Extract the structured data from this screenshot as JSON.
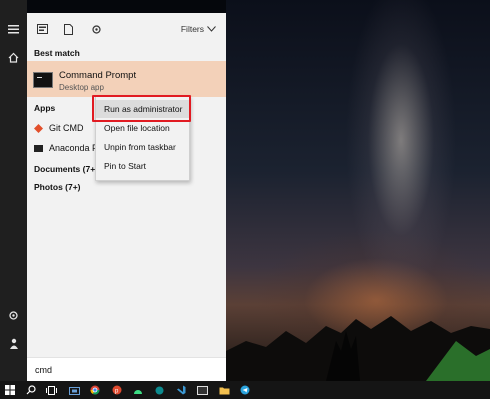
{
  "start_menu": {
    "filters_label": "Filters",
    "sections": {
      "best_match": "Best match",
      "apps": "Apps",
      "documents": "Documents (7+)",
      "photos": "Photos (7+)"
    },
    "best_match_item": {
      "title": "Command Prompt",
      "subtitle": "Desktop app"
    },
    "apps": [
      {
        "label": "Git CMD"
      },
      {
        "label": "Anaconda P"
      }
    ],
    "search_query": "cmd"
  },
  "context_menu": {
    "items": [
      {
        "label": "Run as administrator",
        "highlighted": true
      },
      {
        "label": "Open file location"
      },
      {
        "label": "Unpin from taskbar"
      },
      {
        "label": "Pin to Start"
      }
    ]
  },
  "icons": {
    "rail": [
      "hamburger-icon",
      "home-icon",
      "settings-icon",
      "user-icon"
    ],
    "toolbar": [
      "apps-icon",
      "documents-icon",
      "settings-icon"
    ],
    "taskbar": [
      "windows-start-icon",
      "search-icon",
      "task-view-icon",
      "store-icon",
      "chrome-icon",
      "pdf-icon",
      "android-icon",
      "vscode-icon",
      "terminal-icon",
      "file-explorer-icon",
      "telegram-icon"
    ]
  },
  "colors": {
    "best_match_bg": "#f3d1b9",
    "highlight_border": "#e11b22",
    "rail_bg": "#1f1f1f",
    "taskbar_bg": "#151515"
  }
}
